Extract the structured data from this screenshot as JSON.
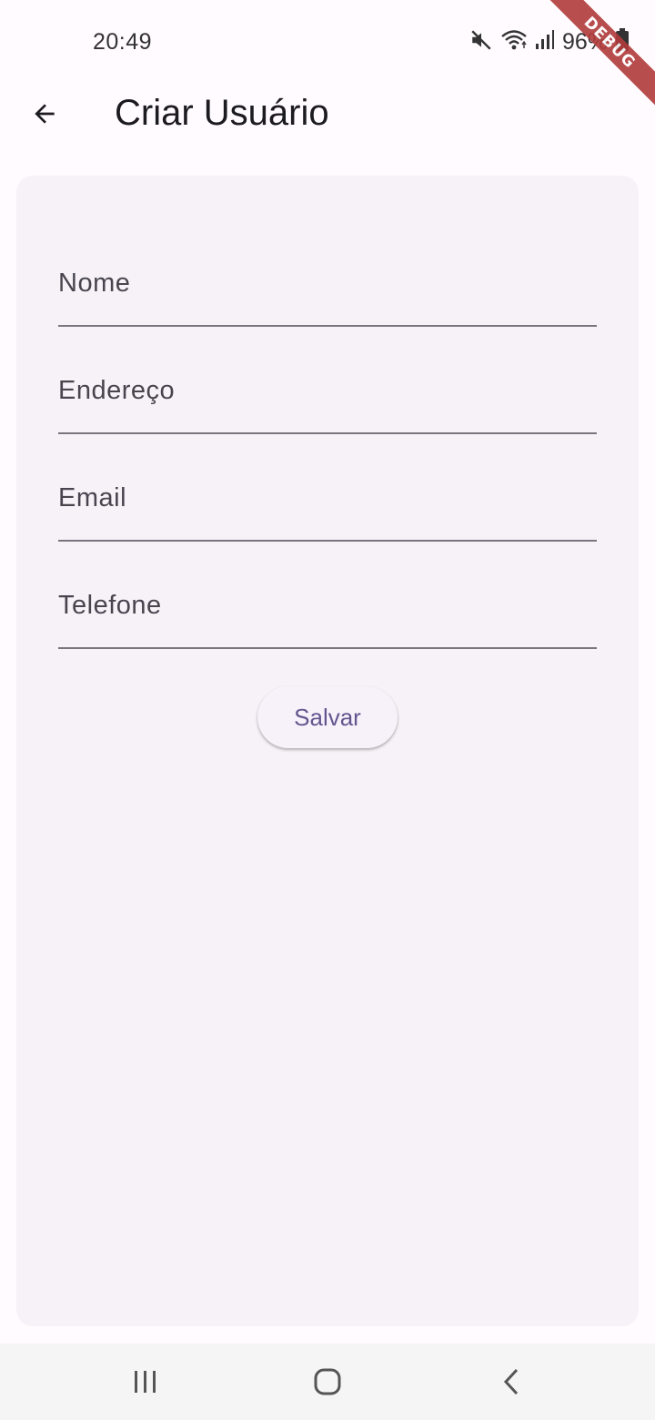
{
  "status_bar": {
    "time": "20:49",
    "battery": "96%",
    "icons": [
      "mute-icon",
      "wifi-icon",
      "signal-icon",
      "battery-icon"
    ]
  },
  "debug_banner": "DEBUG",
  "app_bar": {
    "title": "Criar Usuário",
    "back_icon": "arrow-back-icon"
  },
  "form": {
    "fields": [
      {
        "label": "Nome",
        "value": ""
      },
      {
        "label": "Endereço",
        "value": ""
      },
      {
        "label": "Email",
        "value": ""
      },
      {
        "label": "Telefone",
        "value": ""
      }
    ],
    "save_label": "Salvar"
  },
  "nav_bar": {
    "icons": [
      "recent-apps-icon",
      "home-icon",
      "back-icon"
    ]
  },
  "colors": {
    "background": "#fffbfe",
    "card": "#f6f2f8",
    "accent": "#65558f",
    "underline": "#79747e",
    "debug": "#b13b3b"
  }
}
